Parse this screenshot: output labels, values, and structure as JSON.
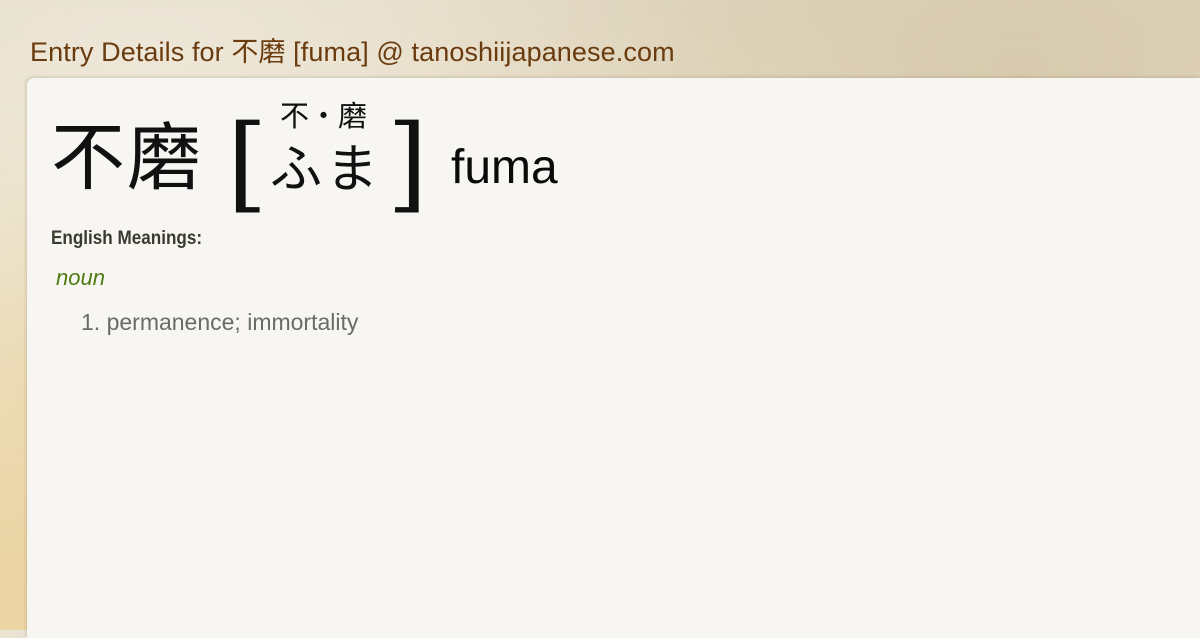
{
  "page": {
    "title": "Entry Details for 不磨 [fuma] @ tanoshiijapanese.com"
  },
  "entry": {
    "kanji": "不磨",
    "bracket_open": "[",
    "bracket_close": "]",
    "furigana": "不・磨",
    "reading": "ふま",
    "romaji": "fuma",
    "meanings_heading": "English Meanings:",
    "part_of_speech": "noun",
    "meanings": [
      "1. permanence; immortality"
    ]
  },
  "colors": {
    "header_text": "#6a3b0e",
    "part_of_speech": "#4e7a10",
    "meaning_text": "#6a6a6a",
    "card_background": "#f7f6f2"
  }
}
